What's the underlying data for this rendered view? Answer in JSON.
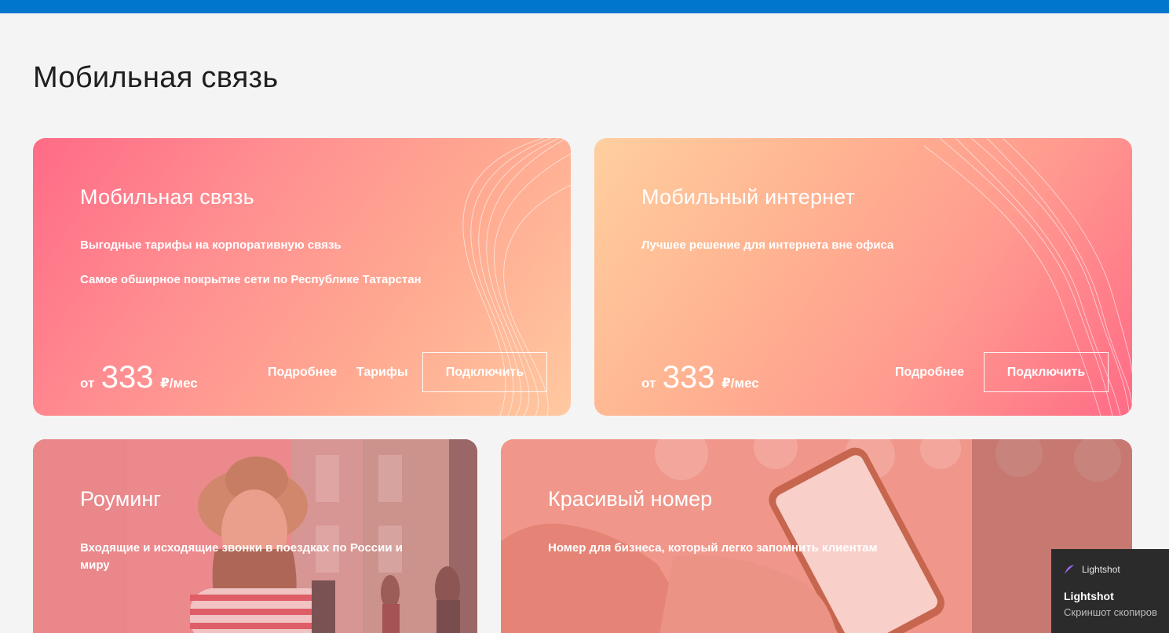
{
  "page": {
    "title": "Мобильная связь"
  },
  "cards": {
    "mobile": {
      "title": "Мобильная связь",
      "lines": [
        "Выгодные тарифы на корпоративную связь",
        "Самое обширное покрытие сети по Республике Татарстан"
      ],
      "price_prefix": "от",
      "price_value": "333",
      "price_unit": "₽/мес",
      "link_more": "Подробнее",
      "link_tariffs": "Тарифы",
      "connect": "Подключить"
    },
    "internet": {
      "title": "Мобильный интернет",
      "lines": [
        "Лучшее решение для интернета вне офиса"
      ],
      "price_prefix": "от",
      "price_value": "333",
      "price_unit": "₽/мес",
      "link_more": "Подробнее",
      "connect": "Подключить"
    },
    "roaming": {
      "title": "Роуминг",
      "text": "Входящие и исходящие звонки в поездках по России и миру"
    },
    "number": {
      "title": "Красивый номер",
      "text": "Номер для бизнеса, который легко запомнить клиентам"
    }
  },
  "notification": {
    "app_name": "Lightshot",
    "title": "Lightshot",
    "body": "Скриншот скопиров"
  },
  "colors": {
    "top_bar": "#0076cc",
    "page_bg": "#f4f4f4",
    "card_pink": "#ff6b86",
    "card_peach": "#ffc9a0"
  }
}
